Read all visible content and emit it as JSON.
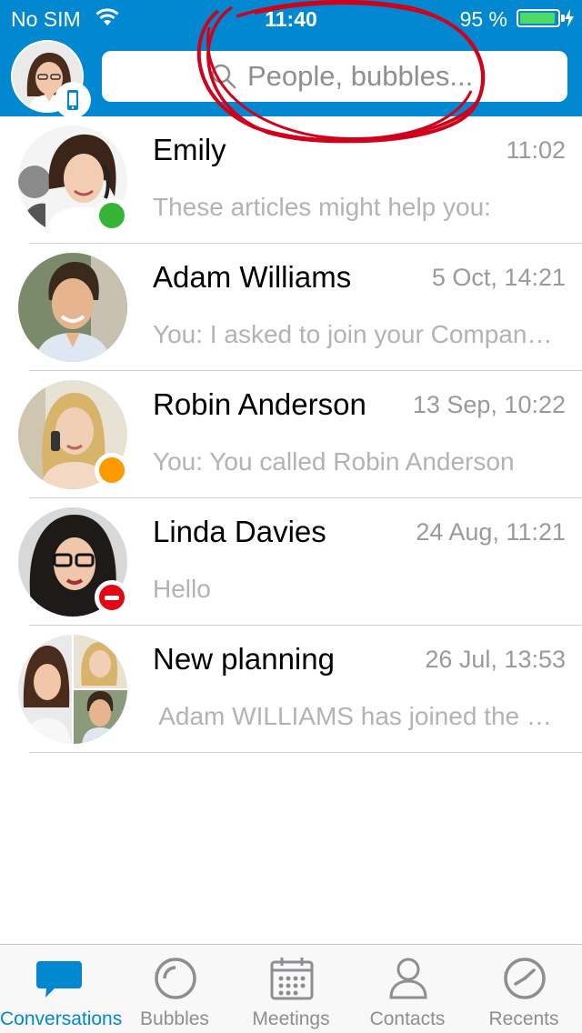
{
  "status_bar": {
    "carrier": "No SIM",
    "time": "11:40",
    "battery_percent": "95 %",
    "battery_level": 0.95
  },
  "search": {
    "placeholder": "People, bubbles..."
  },
  "colors": {
    "brand": "#0288d1",
    "online": "#35b536",
    "away": "#ff9900",
    "busy": "#e30613",
    "annotation": "#d0021b"
  },
  "conversations": [
    {
      "name": "Emily",
      "time": "11:02",
      "preview": "These articles might help you:",
      "presence": "online"
    },
    {
      "name": "Adam Williams",
      "time": "5 Oct, 14:21",
      "preview": "You: I asked to join your Company",
      "emoji": "slightly-smiling-face-icon",
      "presence": "none"
    },
    {
      "name": "Robin Anderson",
      "time": "13 Sep, 10:22",
      "preview": "You: You called Robin Anderson",
      "presence": "away"
    },
    {
      "name": "Linda Davies",
      "time": "24 Aug, 11:21",
      "preview": "Hello",
      "presence": "busy"
    },
    {
      "name": "New planning",
      "time": "26 Jul, 13:53",
      "preview": " Adam WILLIAMS has joined the bub...",
      "presence": "none"
    }
  ],
  "tabs": [
    {
      "label": "Conversations",
      "icon": "chat-bubble-icon",
      "active": true
    },
    {
      "label": "Bubbles",
      "icon": "bubble-circle-icon",
      "active": false
    },
    {
      "label": "Meetings",
      "icon": "calendar-icon",
      "active": false
    },
    {
      "label": "Contacts",
      "icon": "person-icon",
      "active": false
    },
    {
      "label": "Recents",
      "icon": "clock-icon",
      "active": false
    }
  ]
}
